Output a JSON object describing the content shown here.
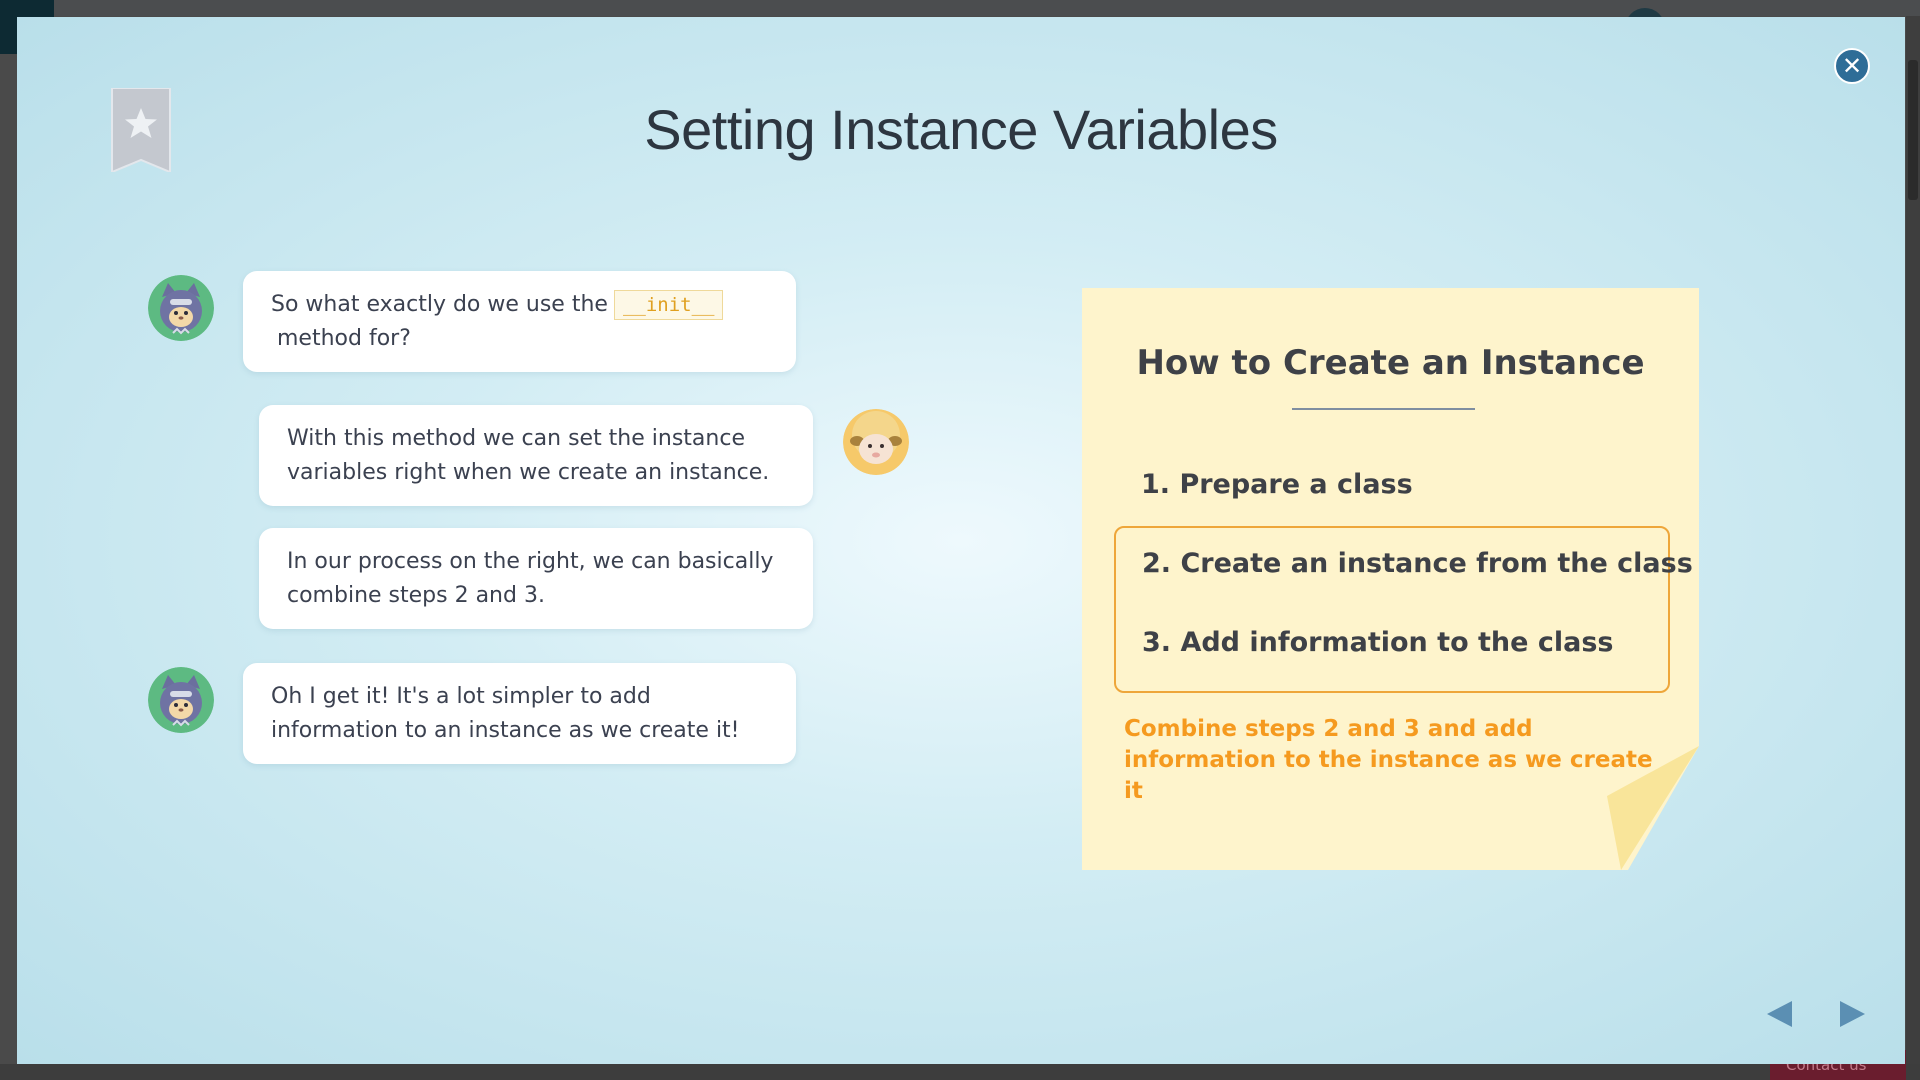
{
  "lesson": {
    "title": "Setting Instance Variables"
  },
  "chat": [
    {
      "speaker": "cat",
      "pre": "So what exactly do we use the",
      "code": "__init__",
      "post": "method for?"
    },
    {
      "speaker": "sheep",
      "text": "With this method we can set the instance variables right when we create an instance."
    },
    {
      "speaker": "sheep",
      "text": "In our process on the right, we can basically combine steps 2 and 3."
    },
    {
      "speaker": "cat",
      "text": "Oh I get it! It's a lot simpler to add information to an instance as we create it!"
    }
  ],
  "note": {
    "title": "How to Create an Instance",
    "steps": [
      "1. Prepare a class",
      "2. Create an instance from the class",
      "3. Add information to the class"
    ],
    "caption_line1": "Combine steps 2 and 3 and add",
    "caption_line2": "information to the instance as we create it"
  },
  "background": {
    "contact_label": "Contact us"
  },
  "icons": {
    "close": "close-icon",
    "bookmark": "bookmark-star-icon",
    "prev": "arrow-left-icon",
    "next": "arrow-right-icon"
  },
  "colors": {
    "accent_orange": "#f59a1f",
    "note_bg": "#fef4cc",
    "close_blue": "#2e6d97",
    "nav_blue": "#5b8fb3"
  }
}
